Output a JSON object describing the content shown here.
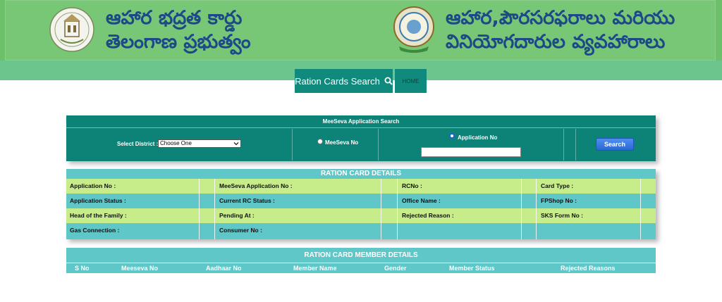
{
  "header": {
    "left_title_line1": "ఆహార భద్రత కార్డు",
    "left_title_line2": "తెలంగాణ ప్రభుత్వం",
    "right_title_line1": "ఆహార,పౌరసరఫరాలు మరియు",
    "right_title_line2": "వినియోగదారుల వ్యవహారాలు",
    "left_emblem": "government-of-telangana-emblem",
    "right_emblem": "civil-supplies-department-emblem"
  },
  "nav": {
    "search_label": "Ration Cards Search",
    "search_icon": "magnifier-icon",
    "home_label": "HOME"
  },
  "meeseva_search": {
    "title": "MeeSeva Application Search",
    "district_label": "Select District :",
    "district_selected": "Choose One",
    "radio_meeseva_label": "MeeSeva No",
    "radio_application_label": "Application No",
    "selected_radio": "Application No",
    "application_input_value": "",
    "search_button_label": "Search"
  },
  "ration_card_details": {
    "title": "RATION CARD DETAILS",
    "rows": [
      [
        "Application No :",
        "MeeSeva Application No :",
        "RCNo :",
        "Card Type :"
      ],
      [
        "Application Status :",
        "Current RC Status :",
        "Office Name :",
        "FPShop No :"
      ],
      [
        "Head of the Family :",
        "Pending At :",
        "Rejected Reason :",
        "SKS Form No :"
      ],
      [
        "Gas Connection :",
        "Consumer No :",
        "",
        ""
      ]
    ]
  },
  "member_details": {
    "title": "RATION CARD MEMBER DETAILS",
    "columns": [
      "S No",
      "Meeseva No",
      "Aadhaar No",
      "Member Name",
      "Gender",
      "Member Status",
      "Rejected Reasons"
    ]
  },
  "colors": {
    "banner_green": "#78c776",
    "teal_dark": "#0d8378",
    "teal_light": "#5fc7c7",
    "row_light_green": "#c7ec8a",
    "title_blue": "#1d4a86",
    "button_blue": "#2a67d4"
  }
}
